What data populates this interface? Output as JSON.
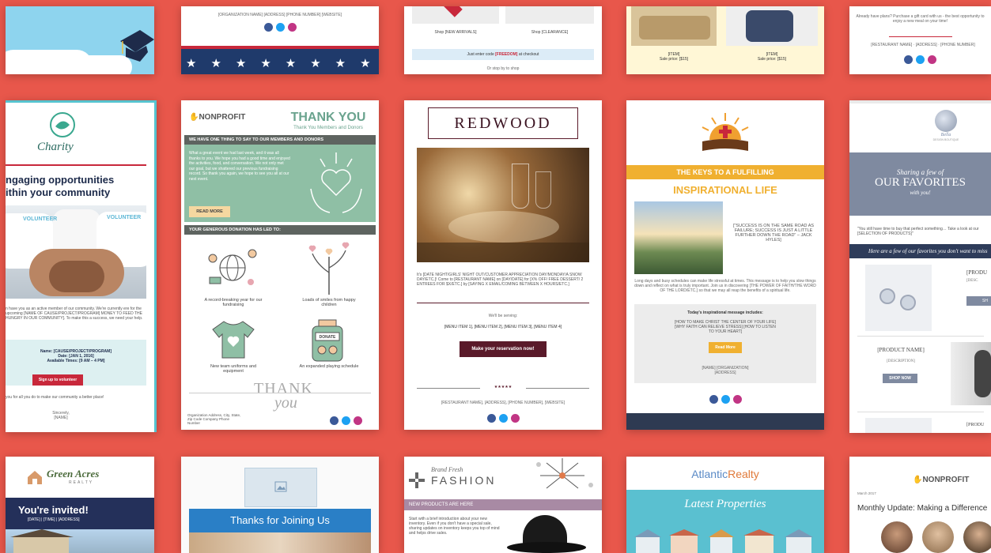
{
  "r1": {
    "c2_footer": "[ORGANIZATION NAME] [ADDRESS] [PHONE NUMBER] [WEBSITE]",
    "c3_shop1": "Shop [NEW ARRIVALS]",
    "c3_shop2": "Shop [CLEARANCE]",
    "c3_code_pre": "Just enter code ",
    "c3_code": "[FREEDOM]",
    "c3_code_post": " at checkout",
    "c3_stop": "Or stop by to shop",
    "c4_item1": "[ITEM]",
    "c4_price1": "Sale price: [$15]",
    "c4_item2": "[ITEM]",
    "c4_price2": "Sale price: [$15]",
    "c5_text": "Already have plans? Purchase a gift card with us - the best opportunity to enjoy a new meal on your time!",
    "c5_footer": "[RESTAURANT NAME] · [ADDRESS] · [PHONE NUMBER]"
  },
  "charity": {
    "logo_text": "Charity",
    "heading1": "ngaging opportunities",
    "heading2": "ithin your community",
    "photo_label1": "VOLUNTEER",
    "photo_label2": "VOLUNTEER",
    "body": "n have you as an active member of our community. We're currently ere for the upcoming [NAME OF CAUSE/PROJECT/PROGRAM] MONEY TO FEED THE HUNGRY IN OUR COMMUNITY]. To make this a success, we need your help.",
    "name": "Name: [CAUSE/PROJECT/PROGRAM]",
    "date": "Date: [JAN 1, 2016]",
    "times": "Available Times: [9 AM – 4 PM]",
    "button": "Sign up to volunteer",
    "thanks": "you for all you do to make our community a better place!",
    "sincerely": "Sincerely,",
    "sign": "[NAME]"
  },
  "nonprofit": {
    "logo": "NONPROFIT",
    "title": "THANK YOU",
    "subtitle": "Thank You Members and Donors",
    "bar1": "WE HAVE ONE THING TO SAY TO OUR MEMBERS AND DONORS",
    "body": "What a great event we had last week, and it was all thanks to you. We hope you had a good time and enjoyed the activities, food, and conversation. We not only met our goal, but we shattered our previous fundraising record. So thank you again, we hope to see you all at our next event.",
    "read_more": "READ MORE",
    "bar2": "YOUR GENEROUS DONATION HAS LED TO:",
    "item1": "A record-breaking year for our fundraising",
    "item2": "Loads of smiles from happy children",
    "item3": "New team uniforms and equipment",
    "item4": "An expanded playing schedule",
    "donate": "DONATE",
    "thank": "THANK",
    "you": "you",
    "address": "Organization Address, City, State, Zip Code Company Phone Number"
  },
  "redwood": {
    "title": "REDWOOD",
    "body": "It's [DATE NIGHT/GIRLS' NIGHT OUT/CUSTOMER APPRECIATION DAY/MONDAY/A SNOW DAY/ETC.]! Come to [RESTAURANT NAME] on [DAY/DATE] for [X% OFF/ FREE DESSERT/ 2 ENTREES FOR $X/ETC.] by [SAYING X EMAIL/COMING BETWEEN X HOURS/ETC.]",
    "serving": "We'll be serving:",
    "menu": "[MENU ITEM 1], [MENU ITEM 2], [MENU ITEM 3], [MENU ITEM 4]",
    "button": "Make your reservation now!",
    "stars": "★★★★★",
    "footer": "[RESTAURANT NAME], [ADDRESS], [PHONE NUMBER], [WEBSITE]"
  },
  "church": {
    "bar": "THE KEYS TO A FULFILLING",
    "title": "INSPIRATIONAL LIFE",
    "quote": "[\"SUCCESS IS ON THE SAME ROAD AS FAILURE; SUCCESS IS JUST A LITTLE FURTHER DOWN THE ROAD\" – JACK HYLES]",
    "body": "Long days and busy schedules can make life stressful at times. This message is to help you slow things down and reflect on what is truly important. Join us in discovering [THE POWER OF FAITH/THE WORD OF THE LORD/ETC.] so that we may all reap the benefits of a spiritual life.",
    "today": "Today's inspirational message includes:",
    "list": "[HOW TO MAKE CHRIST THE CENTER OF YOUR LIFE] [WHY FAITH CAN RELIEVE STRESS] [HOW TO LISTEN TO YOUR HEART]",
    "button": "Read More",
    "footer": "[NAME] [ORGANIZATION] [ADDRESS]"
  },
  "boutique": {
    "brand": "Bella",
    "brand_sub": "DESIGN BOUTIQUE",
    "banner1": "Sharing a few of",
    "banner2": "OUR FAVORITES",
    "banner3": "with you!",
    "text": "\"You still have time to buy that perfect something… Take a look at our [SELECTION OF PRODUCTS]\"",
    "strip": "Here are a few of our favorites you don't want to miss",
    "product1": "[PRODU",
    "desc1": "[DESC",
    "shop1": "SH",
    "product2": "[PRODUCT NAME]",
    "desc2": "[DESCRIPTION]",
    "shop2": "SHOP NOW",
    "product3": "[PRODU"
  },
  "r3": {
    "greenacres1": "Green Acres",
    "greenacres2": "REALTY",
    "invited": "You're invited!",
    "invited_sub": "[DATE] | [TIME] | [ADDRESS]",
    "thanks": "Thanks for Joining Us",
    "fashion_brand": "Brand Fresh",
    "fashion": "FASHION",
    "new_products": "NEW PRODUCTS ARE HERE",
    "fashion_body": "Start with a brief introduction about your new inventory. Even if you don't have a special sale, sharing updates on inventory keeps you top of mind and helps drive sales.",
    "atlantic1": "Atlantic",
    "atlantic2": "Realty",
    "latest": "Latest Properties",
    "np_logo": "NONPROFIT",
    "np_date": "March 2017",
    "np_title": "Monthly Update: Making a Difference"
  }
}
